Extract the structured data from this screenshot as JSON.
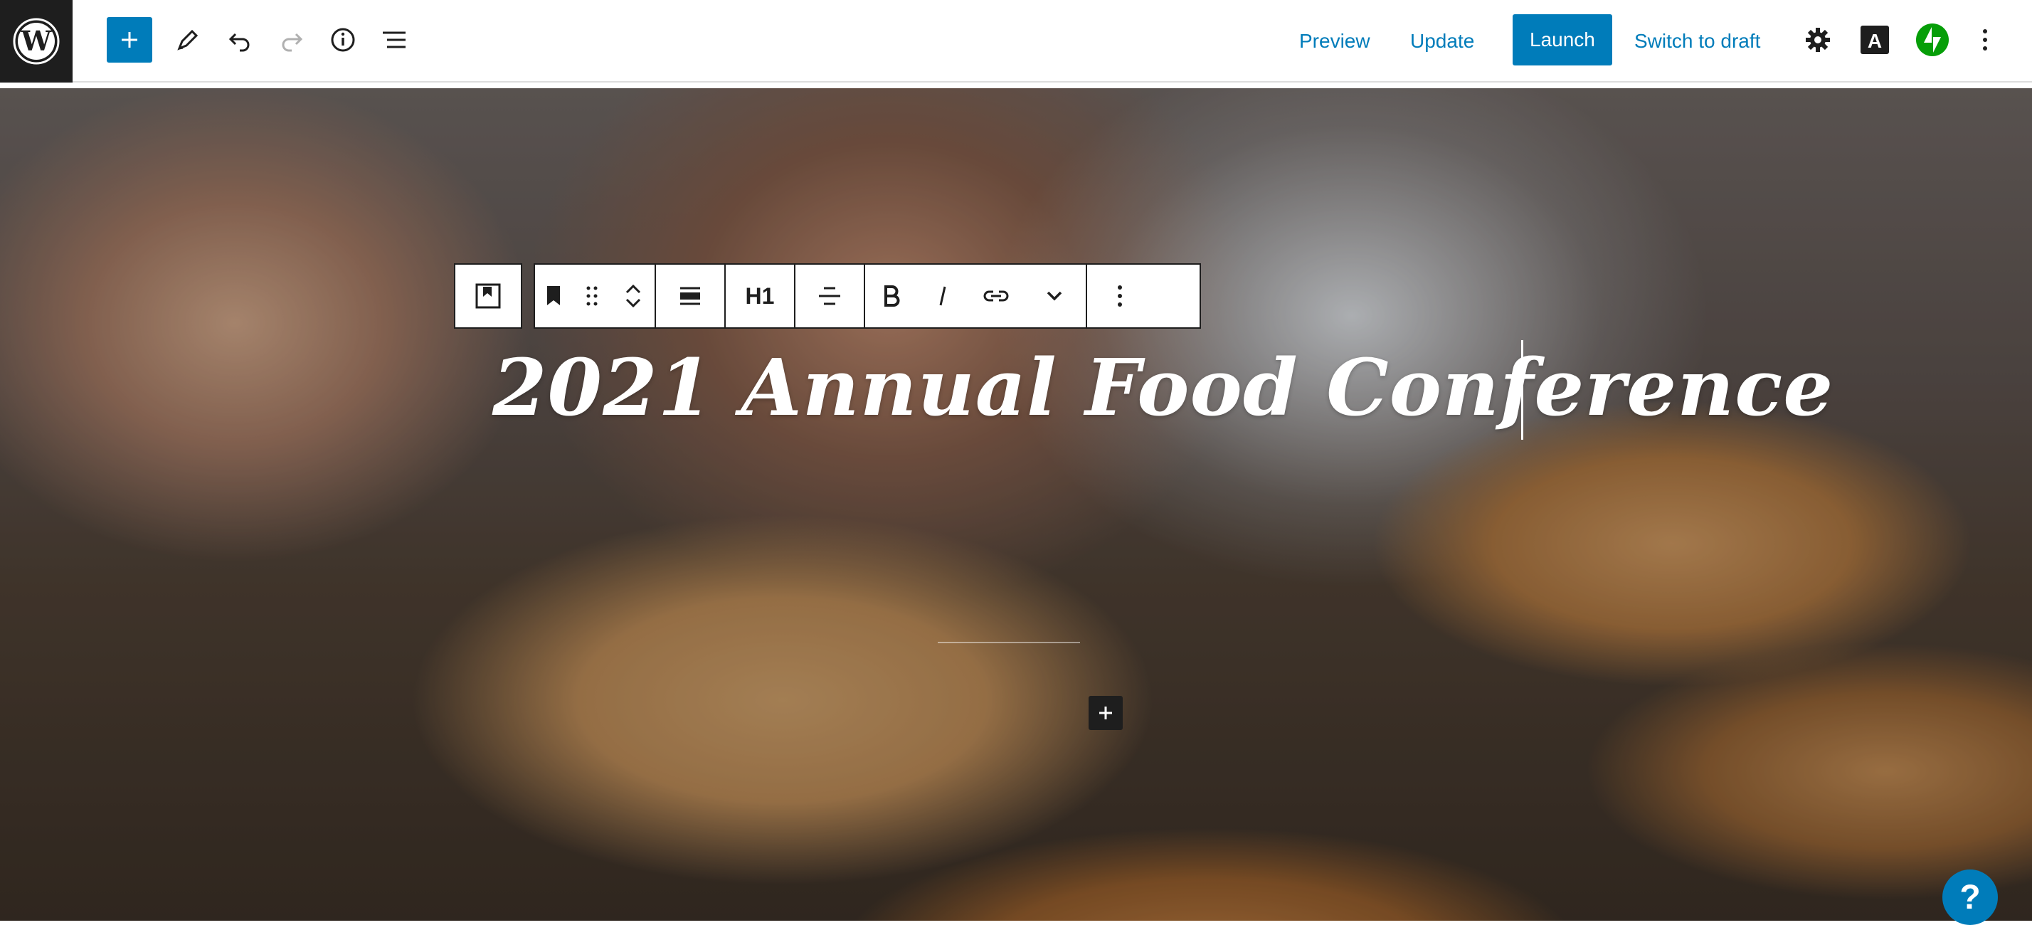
{
  "topbar": {
    "preview_label": "Preview",
    "update_label": "Update",
    "launch_label": "Launch",
    "switch_draft_label": "Switch to draft",
    "icons": [
      "wordpress-logo-icon",
      "plus-icon",
      "pencil-icon",
      "undo-icon",
      "redo-icon",
      "info-icon",
      "list-view-icon",
      "gear-icon",
      "typography-icon",
      "jetpack-icon",
      "more-vertical-icon"
    ]
  },
  "block_toolbar": {
    "heading_level": "H1",
    "icons": [
      "block-switcher-icon",
      "bookmark-icon",
      "drag-handle-icon",
      "move-up-icon",
      "move-down-icon",
      "align-full-icon",
      "text-align-icon",
      "bold-icon",
      "italic-icon",
      "link-icon",
      "chevron-down-icon",
      "more-options-icon"
    ]
  },
  "cover": {
    "heading": "2021 Annual Food Conference"
  },
  "help_label": "?",
  "colors": {
    "accent": "#007cba",
    "dark": "#1e1e1e",
    "jetpack": "#069e08"
  }
}
